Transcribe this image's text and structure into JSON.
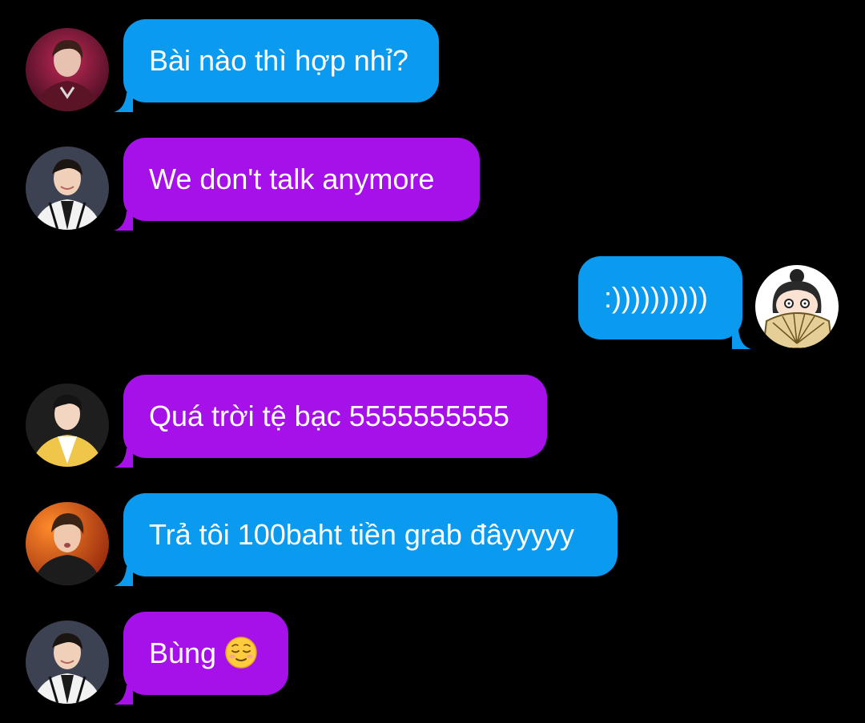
{
  "colors": {
    "blue_bubble": "#0A9BF0",
    "purple_bubble": "#A511E8",
    "background": "#000000",
    "text": "#FFFFFF"
  },
  "messages": [
    {
      "side": "left",
      "color": "blue",
      "avatar": "avatar-singer-red-stage",
      "text": "Bài nào thì hợp nhỉ?"
    },
    {
      "side": "left",
      "color": "purple",
      "avatar": "avatar-man-white-jacket",
      "text": "We don't talk anymore"
    },
    {
      "side": "right",
      "color": "blue",
      "avatar": "avatar-cartoon-girl-fan",
      "text": ":))))))))))"
    },
    {
      "side": "left",
      "color": "purple",
      "avatar": "avatar-man-yellow-jacket",
      "text": "Quá trời tệ bạc 5555555555"
    },
    {
      "side": "left",
      "color": "blue",
      "avatar": "avatar-singer-orange-light",
      "text": "Trả tôi 100baht tiền grab đâyyyyy"
    },
    {
      "side": "left",
      "color": "purple",
      "avatar": "avatar-man-white-jacket",
      "text": "Bùng",
      "emoji": "relieved-face-emoji"
    }
  ]
}
